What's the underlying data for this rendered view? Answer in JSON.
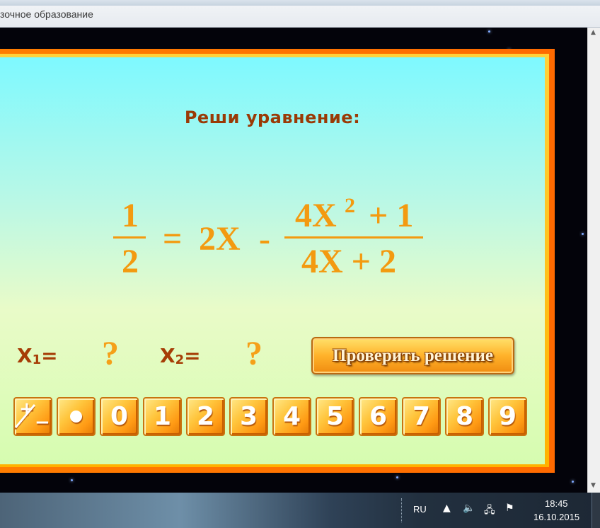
{
  "window": {
    "title": "зочное образование"
  },
  "game": {
    "prompt": "Реши уравнение:",
    "equation": {
      "lhs_numerator": "1",
      "lhs_denominator": "2",
      "equals": "=",
      "term": "2X",
      "minus": "-",
      "rhs_numerator": "4X",
      "rhs_exponent": "2",
      "rhs_numerator_rest": "+ 1",
      "rhs_denominator": "4X + 2"
    },
    "answers": {
      "x1_label": "X",
      "x1_sub": "1",
      "x1_eq": "=",
      "x1_value": "?",
      "x2_label": "X",
      "x2_sub": "2",
      "x2_eq": "=",
      "x2_value": "?"
    },
    "check_button": "Проверить решение",
    "keypad": {
      "plus_minus_plus": "+",
      "plus_minus_minus": "−",
      "digits": [
        "0",
        "1",
        "2",
        "3",
        "4",
        "5",
        "6",
        "7",
        "8",
        "9"
      ]
    }
  },
  "taskbar": {
    "language": "RU",
    "time": "18:45",
    "date": "16.10.2015"
  },
  "colors": {
    "prompt": "#9a3a06",
    "equation": "#f39a10",
    "frame_orange": "#ff7d00",
    "board_top": "#7ef9ff",
    "board_bottom": "#d6fcb0"
  }
}
